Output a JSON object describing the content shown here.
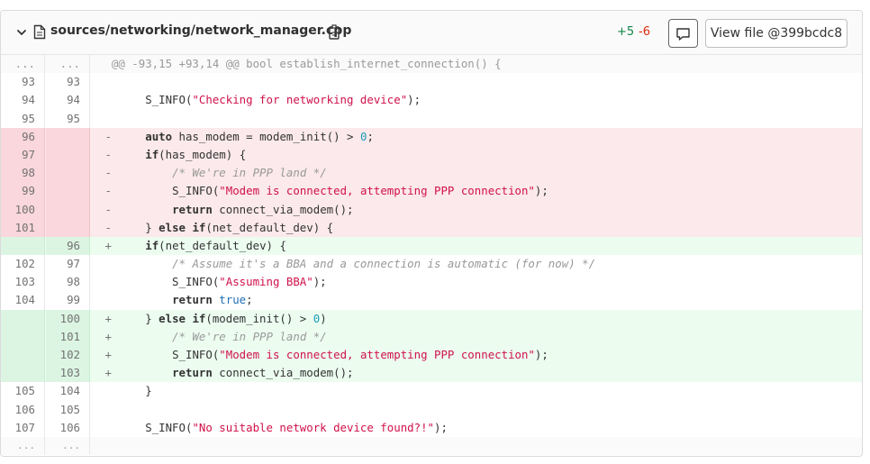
{
  "file": {
    "path": "sources/networking/network_manager.cpp",
    "additions": "+5",
    "deletions": "-6",
    "view_button": "View file @399bcdc8"
  },
  "colors": {
    "add": "#108548",
    "del": "#dd2b0e",
    "old_bg": "#fbe9eb",
    "new_bg": "#ecfdf0"
  },
  "icons": [
    "chevron-down-icon",
    "file-icon",
    "copy-icon",
    "comment-icon"
  ],
  "lines": [
    {
      "type": "hunk",
      "old": "...",
      "new": "...",
      "sign": "",
      "html": "@@ -93,15 +93,14 @@ bool establish_internet_connection() {"
    },
    {
      "type": "ctx",
      "old": "93",
      "new": "93",
      "sign": "",
      "html": ""
    },
    {
      "type": "ctx",
      "old": "94",
      "new": "94",
      "sign": "",
      "html": "    S_INFO(<span class=\"str\">\"Checking for networking device\"</span>);"
    },
    {
      "type": "ctx",
      "old": "95",
      "new": "95",
      "sign": "",
      "html": ""
    },
    {
      "type": "old",
      "old": "96",
      "new": "",
      "sign": "-",
      "html": "    <span class=\"kw\">auto</span> has_modem = modem_init() &gt; <span class=\"num\">0</span>;"
    },
    {
      "type": "old",
      "old": "97",
      "new": "",
      "sign": "-",
      "html": "    <span class=\"kw\">if</span>(has_modem) {"
    },
    {
      "type": "old",
      "old": "98",
      "new": "",
      "sign": "-",
      "html": "        <span class=\"cm\">/* We're in PPP land */</span>"
    },
    {
      "type": "old",
      "old": "99",
      "new": "",
      "sign": "-",
      "html": "        S_INFO(<span class=\"str\">\"Modem is connected, attempting PPP connection\"</span>);"
    },
    {
      "type": "old",
      "old": "100",
      "new": "",
      "sign": "-",
      "html": "        <span class=\"kw\">return</span> connect_via_modem();"
    },
    {
      "type": "old",
      "old": "101",
      "new": "",
      "sign": "-",
      "html": "    } <span class=\"kw\">else if</span>(net_default_dev) {"
    },
    {
      "type": "new",
      "old": "",
      "new": "96",
      "sign": "+",
      "html": "    <span class=\"kw\">if</span>(net_default_dev) {"
    },
    {
      "type": "ctx",
      "old": "102",
      "new": "97",
      "sign": "",
      "html": "        <span class=\"cm\">/* Assume it's a BBA and a connection is automatic (for now) */</span>"
    },
    {
      "type": "ctx",
      "old": "103",
      "new": "98",
      "sign": "",
      "html": "        S_INFO(<span class=\"str\">\"Assuming BBA\"</span>);"
    },
    {
      "type": "ctx",
      "old": "104",
      "new": "99",
      "sign": "",
      "html": "        <span class=\"kw\">return</span> <span class=\"kwv\">true</span>;"
    },
    {
      "type": "new",
      "old": "",
      "new": "100",
      "sign": "+",
      "html": "    } <span class=\"kw\">else if</span>(modem_init() &gt; <span class=\"num\">0</span>)"
    },
    {
      "type": "new",
      "old": "",
      "new": "101",
      "sign": "+",
      "html": "        <span class=\"cm\">/* We're in PPP land */</span>"
    },
    {
      "type": "new",
      "old": "",
      "new": "102",
      "sign": "+",
      "html": "        S_INFO(<span class=\"str\">\"Modem is connected, attempting PPP connection\"</span>);"
    },
    {
      "type": "new",
      "old": "",
      "new": "103",
      "sign": "+",
      "html": "        <span class=\"kw\">return</span> connect_via_modem();"
    },
    {
      "type": "ctx",
      "old": "105",
      "new": "104",
      "sign": "",
      "html": "    }"
    },
    {
      "type": "ctx",
      "old": "106",
      "new": "105",
      "sign": "",
      "html": ""
    },
    {
      "type": "ctx",
      "old": "107",
      "new": "106",
      "sign": "",
      "html": "    S_INFO(<span class=\"str\">\"No suitable network device found?!\"</span>);"
    },
    {
      "type": "exp",
      "old": "...",
      "new": "...",
      "sign": "",
      "html": ""
    }
  ]
}
